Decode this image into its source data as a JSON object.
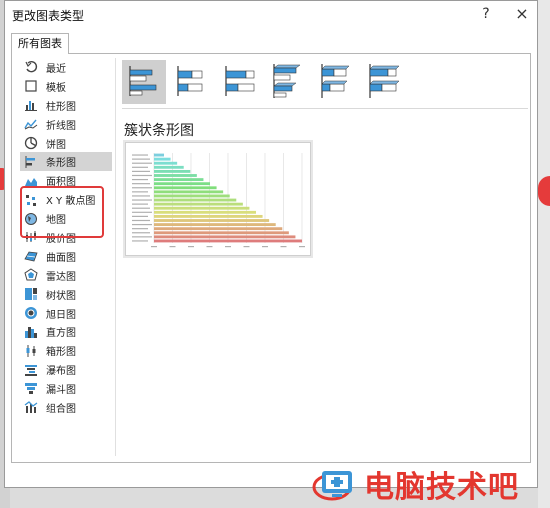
{
  "window": {
    "title": "更改图表类型",
    "help_label": "?",
    "close_label": "×"
  },
  "tabs": [
    {
      "label": "所有图表"
    }
  ],
  "sidebar": {
    "items": [
      {
        "label": "最近",
        "icon": "recent-icon"
      },
      {
        "label": "模板",
        "icon": "template-icon"
      },
      {
        "label": "柱形图",
        "icon": "column-chart-icon"
      },
      {
        "label": "折线图",
        "icon": "line-chart-icon"
      },
      {
        "label": "饼图",
        "icon": "pie-chart-icon"
      },
      {
        "label": "条形图",
        "icon": "bar-chart-icon",
        "selected": true
      },
      {
        "label": "面积图",
        "icon": "area-chart-icon"
      },
      {
        "label": "X Y 散点图",
        "icon": "scatter-chart-icon"
      },
      {
        "label": "地图",
        "icon": "map-chart-icon"
      },
      {
        "label": "股价图",
        "icon": "stock-chart-icon"
      },
      {
        "label": "曲面图",
        "icon": "surface-chart-icon"
      },
      {
        "label": "雷达图",
        "icon": "radar-chart-icon"
      },
      {
        "label": "树状图",
        "icon": "treemap-chart-icon"
      },
      {
        "label": "旭日图",
        "icon": "sunburst-chart-icon"
      },
      {
        "label": "直方图",
        "icon": "histogram-chart-icon"
      },
      {
        "label": "箱形图",
        "icon": "box-whisker-chart-icon"
      },
      {
        "label": "瀑布图",
        "icon": "waterfall-chart-icon"
      },
      {
        "label": "漏斗图",
        "icon": "funnel-chart-icon"
      },
      {
        "label": "组合图",
        "icon": "combo-chart-icon"
      }
    ]
  },
  "subtypes": [
    {
      "name": "clustered-bar",
      "active": true
    },
    {
      "name": "stacked-bar"
    },
    {
      "name": "100-percent-stacked-bar"
    },
    {
      "name": "3d-clustered-bar"
    },
    {
      "name": "3d-stacked-bar"
    },
    {
      "name": "3d-100-percent-stacked-bar"
    }
  ],
  "main": {
    "chart_type_heading": "簇状条形图"
  },
  "preview": {
    "bars": 22
  },
  "colors": {
    "accent": "#3c95d6",
    "highlight": "#e03a3a",
    "watermark": "#e3372f"
  },
  "watermark": {
    "text": "电脑技术吧"
  }
}
